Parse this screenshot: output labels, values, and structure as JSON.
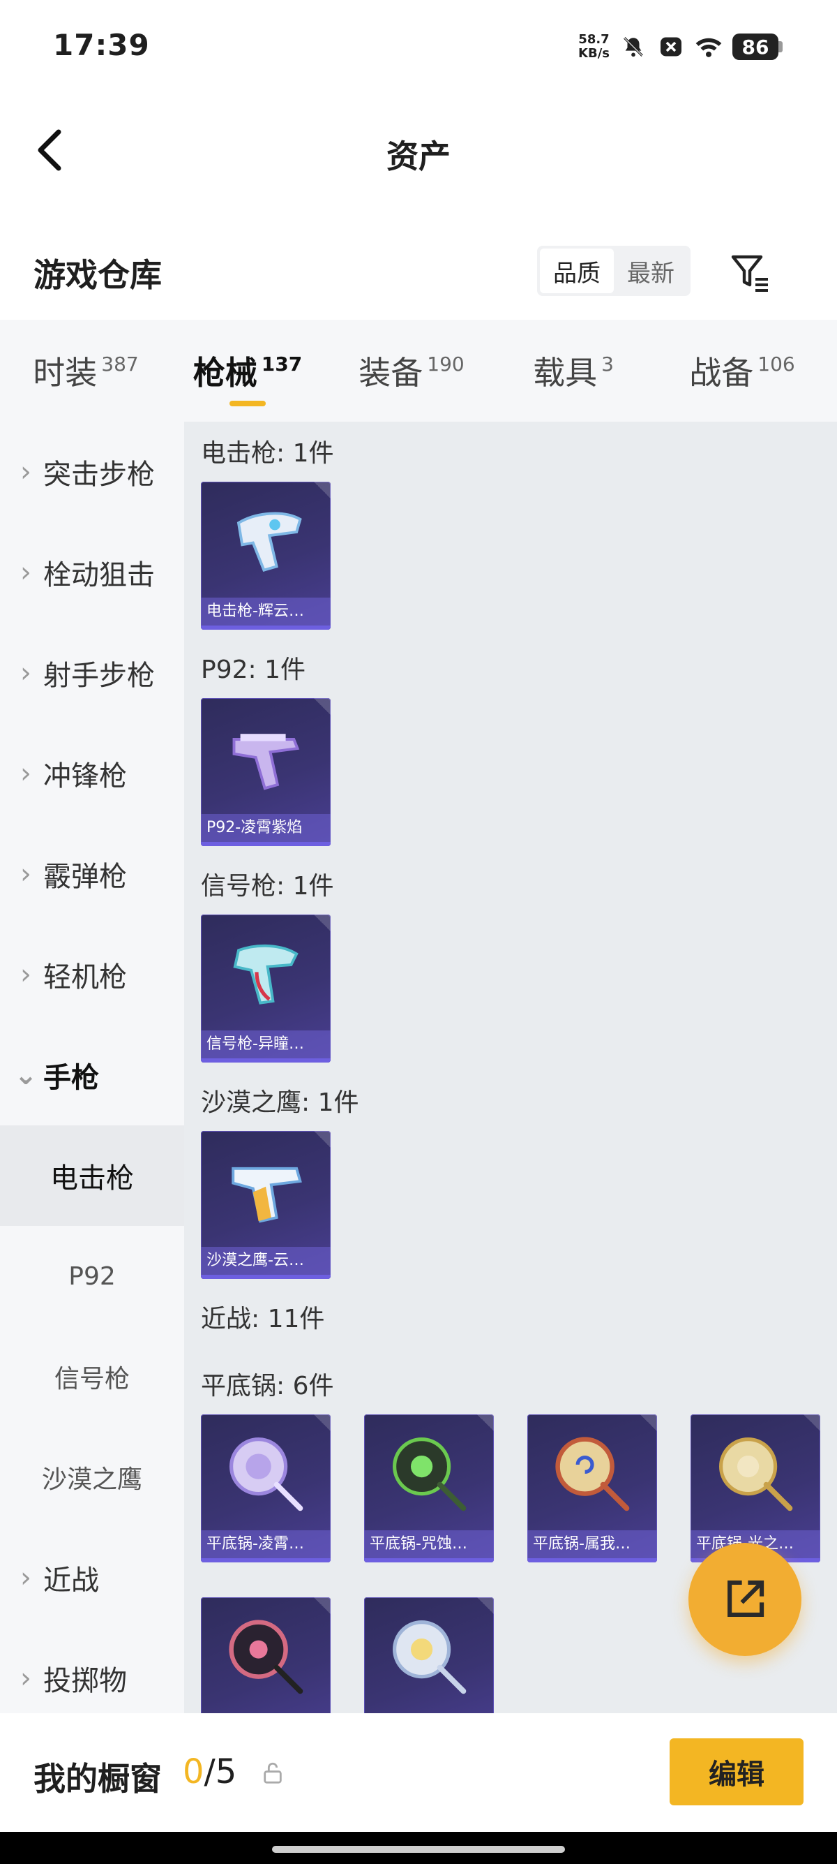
{
  "status": {
    "time": "17:39",
    "net_speed": "58.7",
    "net_unit": "KB/s",
    "battery": "86",
    "icons": [
      "bell-muted-icon",
      "close-box-icon",
      "wifi-icon"
    ]
  },
  "nav": {
    "title": "资产"
  },
  "warehouse": {
    "title": "游戏仓库",
    "sort_options": [
      "品质",
      "最新"
    ],
    "active_sort": "品质"
  },
  "tabs": [
    {
      "label": "时装",
      "count": "387"
    },
    {
      "label": "枪械",
      "count": "137",
      "active": true
    },
    {
      "label": "装备",
      "count": "190"
    },
    {
      "label": "载具",
      "count": "3"
    },
    {
      "label": "战备",
      "count": "106"
    }
  ],
  "sidebar": {
    "categories": [
      {
        "label": "突击步枪"
      },
      {
        "label": "栓动狙击"
      },
      {
        "label": "射手步枪"
      },
      {
        "label": "冲锋枪"
      },
      {
        "label": "霰弹枪"
      },
      {
        "label": "轻机枪"
      },
      {
        "label": "手枪",
        "expanded": true
      }
    ],
    "sub_items": [
      "电击枪",
      "P92",
      "信号枪",
      "沙漠之鹰"
    ],
    "active_sub": "电击枪",
    "categories_after": [
      {
        "label": "近战"
      },
      {
        "label": "投掷物"
      }
    ]
  },
  "content": {
    "groups": [
      {
        "title": "电击枪: 1件",
        "items": [
          {
            "name": "电击枪-辉云…",
            "icon": "stun-gun-icon"
          }
        ]
      },
      {
        "title": "P92: 1件",
        "items": [
          {
            "name": "P92-凌霄紫焰",
            "icon": "pistol-icon"
          }
        ]
      },
      {
        "title": "信号枪: 1件",
        "items": [
          {
            "name": "信号枪-异瞳…",
            "icon": "flare-gun-icon"
          }
        ]
      },
      {
        "title": "沙漠之鹰: 1件",
        "items": [
          {
            "name": "沙漠之鹰-云…",
            "icon": "desert-eagle-icon"
          }
        ]
      },
      {
        "title": "近战: 11件",
        "items": []
      },
      {
        "title": "平底锅: 6件",
        "items": [
          {
            "name": "平底锅-凌霄…",
            "icon": "pan-icon"
          },
          {
            "name": "平底锅-咒蚀…",
            "icon": "pan-icon"
          },
          {
            "name": "平底锅-属我…",
            "icon": "pan-icon"
          },
          {
            "name": "平底锅-光之…",
            "icon": "pan-icon"
          },
          {
            "name": "",
            "icon": "pan-icon"
          },
          {
            "name": "",
            "icon": "pan-icon"
          }
        ]
      }
    ]
  },
  "bottom": {
    "label": "我的橱窗",
    "current": "0",
    "sep_total": "/5",
    "edit_label": "编辑"
  },
  "colors": {
    "accent": "#f3b623",
    "card_bg": "#3a3472",
    "content_bg": "#e9ecef",
    "sidebar_bg": "#f6f7f9"
  }
}
